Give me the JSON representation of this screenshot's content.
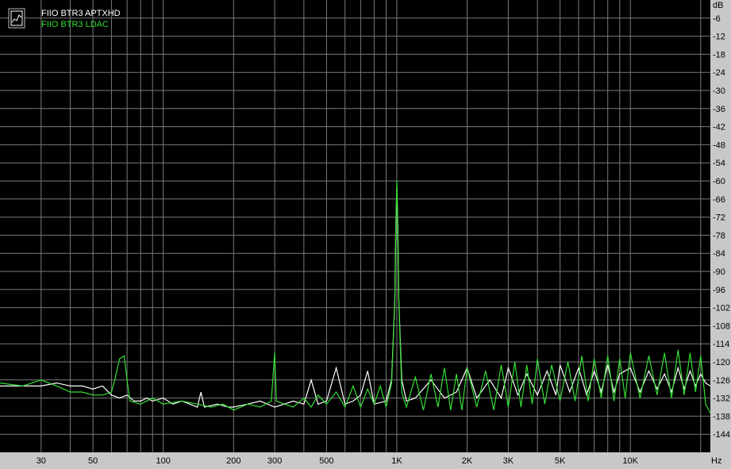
{
  "chart_data": {
    "type": "line",
    "ylabel": "dB",
    "xlabel": "Hz",
    "xscale": "log",
    "xlim": [
      20,
      22000
    ],
    "ylim": [
      -150,
      0
    ],
    "grid": true,
    "legend_position": "top-left",
    "y_ticks": [
      -6,
      -12,
      -18,
      -24,
      -30,
      -36,
      -42,
      -48,
      -54,
      -60,
      -66,
      -72,
      -78,
      -84,
      -90,
      -96,
      -102,
      -108,
      -114,
      -120,
      -126,
      -132,
      -138,
      -144
    ],
    "x_ticks": [
      {
        "value": 30,
        "label": "30"
      },
      {
        "value": 50,
        "label": "50"
      },
      {
        "value": 100,
        "label": "100"
      },
      {
        "value": 200,
        "label": "200"
      },
      {
        "value": 300,
        "label": "300"
      },
      {
        "value": 500,
        "label": "500"
      },
      {
        "value": 1000,
        "label": "1K"
      },
      {
        "value": 2000,
        "label": "2K"
      },
      {
        "value": 3000,
        "label": "3K"
      },
      {
        "value": 5000,
        "label": "5K"
      },
      {
        "value": 10000,
        "label": "10K"
      }
    ],
    "x_minor_grid": [
      40,
      60,
      70,
      80,
      90,
      400,
      600,
      700,
      800,
      900,
      4000,
      6000,
      7000,
      8000,
      9000,
      20000
    ],
    "series": [
      {
        "name": "FIIO BTR3 APTXHD",
        "color": "#ffffff",
        "points": [
          [
            20,
            -128
          ],
          [
            25,
            -128
          ],
          [
            30,
            -128
          ],
          [
            35,
            -127
          ],
          [
            40,
            -128
          ],
          [
            45,
            -128
          ],
          [
            50,
            -129
          ],
          [
            55,
            -128
          ],
          [
            60,
            -131
          ],
          [
            65,
            -132
          ],
          [
            70,
            -131
          ],
          [
            75,
            -133
          ],
          [
            80,
            -133
          ],
          [
            85,
            -132
          ],
          [
            90,
            -133
          ],
          [
            100,
            -132
          ],
          [
            110,
            -134
          ],
          [
            120,
            -133
          ],
          [
            130,
            -134
          ],
          [
            140,
            -135
          ],
          [
            145,
            -130
          ],
          [
            150,
            -135
          ],
          [
            170,
            -134
          ],
          [
            190,
            -135
          ],
          [
            200,
            -135
          ],
          [
            230,
            -134
          ],
          [
            260,
            -133
          ],
          [
            300,
            -135
          ],
          [
            330,
            -134
          ],
          [
            360,
            -133
          ],
          [
            400,
            -134
          ],
          [
            430,
            -126
          ],
          [
            460,
            -134
          ],
          [
            500,
            -133
          ],
          [
            550,
            -122
          ],
          [
            600,
            -134
          ],
          [
            650,
            -133
          ],
          [
            700,
            -131
          ],
          [
            750,
            -123
          ],
          [
            800,
            -134
          ],
          [
            900,
            -133
          ],
          [
            950,
            -126
          ],
          [
            980,
            -100
          ],
          [
            990,
            -75
          ],
          [
            1000,
            -62
          ],
          [
            1010,
            -75
          ],
          [
            1020,
            -100
          ],
          [
            1050,
            -126
          ],
          [
            1100,
            -133
          ],
          [
            1200,
            -132
          ],
          [
            1400,
            -126
          ],
          [
            1600,
            -132
          ],
          [
            1800,
            -130
          ],
          [
            2000,
            -122
          ],
          [
            2200,
            -132
          ],
          [
            2500,
            -126
          ],
          [
            2800,
            -132
          ],
          [
            3000,
            -122
          ],
          [
            3300,
            -131
          ],
          [
            3600,
            -124
          ],
          [
            4000,
            -131
          ],
          [
            4400,
            -123
          ],
          [
            4800,
            -131
          ],
          [
            5000,
            -121
          ],
          [
            5500,
            -130
          ],
          [
            6000,
            -122
          ],
          [
            6500,
            -131
          ],
          [
            7000,
            -123
          ],
          [
            7500,
            -130
          ],
          [
            8000,
            -121
          ],
          [
            8500,
            -130
          ],
          [
            9000,
            -124
          ],
          [
            10000,
            -122
          ],
          [
            11000,
            -130
          ],
          [
            12000,
            -123
          ],
          [
            13000,
            -129
          ],
          [
            14000,
            -124
          ],
          [
            15000,
            -130
          ],
          [
            16000,
            -122
          ],
          [
            17000,
            -129
          ],
          [
            18000,
            -123
          ],
          [
            19000,
            -128
          ],
          [
            20000,
            -124
          ],
          [
            21000,
            -127
          ],
          [
            22000,
            -128
          ]
        ]
      },
      {
        "name": "FIIO BTR3 LDAC",
        "color": "#33dd33",
        "points": [
          [
            20,
            -127
          ],
          [
            25,
            -128
          ],
          [
            30,
            -126
          ],
          [
            35,
            -128
          ],
          [
            40,
            -130
          ],
          [
            45,
            -130
          ],
          [
            50,
            -131
          ],
          [
            55,
            -131
          ],
          [
            60,
            -130
          ],
          [
            62,
            -126
          ],
          [
            65,
            -119
          ],
          [
            68,
            -118
          ],
          [
            70,
            -126
          ],
          [
            72,
            -133
          ],
          [
            80,
            -134
          ],
          [
            90,
            -132
          ],
          [
            100,
            -134
          ],
          [
            120,
            -133
          ],
          [
            140,
            -134
          ],
          [
            160,
            -135
          ],
          [
            180,
            -134
          ],
          [
            200,
            -136
          ],
          [
            230,
            -134
          ],
          [
            260,
            -135
          ],
          [
            290,
            -133
          ],
          [
            300,
            -117
          ],
          [
            305,
            -133
          ],
          [
            330,
            -134
          ],
          [
            360,
            -135
          ],
          [
            400,
            -132
          ],
          [
            430,
            -135
          ],
          [
            460,
            -131
          ],
          [
            500,
            -134
          ],
          [
            550,
            -130
          ],
          [
            600,
            -135
          ],
          [
            650,
            -128
          ],
          [
            700,
            -135
          ],
          [
            750,
            -129
          ],
          [
            800,
            -134
          ],
          [
            850,
            -128
          ],
          [
            900,
            -135
          ],
          [
            950,
            -127
          ],
          [
            980,
            -100
          ],
          [
            990,
            -75
          ],
          [
            1000,
            -60
          ],
          [
            1010,
            -75
          ],
          [
            1020,
            -100
          ],
          [
            1050,
            -130
          ],
          [
            1100,
            -135
          ],
          [
            1200,
            -125
          ],
          [
            1300,
            -136
          ],
          [
            1400,
            -124
          ],
          [
            1500,
            -135
          ],
          [
            1600,
            -122
          ],
          [
            1700,
            -136
          ],
          [
            1800,
            -124
          ],
          [
            1900,
            -136
          ],
          [
            2000,
            -122
          ],
          [
            2200,
            -135
          ],
          [
            2400,
            -123
          ],
          [
            2600,
            -136
          ],
          [
            2800,
            -121
          ],
          [
            3000,
            -135
          ],
          [
            3200,
            -120
          ],
          [
            3400,
            -135
          ],
          [
            3600,
            -121
          ],
          [
            3800,
            -134
          ],
          [
            4000,
            -119
          ],
          [
            4300,
            -134
          ],
          [
            4600,
            -121
          ],
          [
            5000,
            -133
          ],
          [
            5400,
            -120
          ],
          [
            5800,
            -133
          ],
          [
            6200,
            -118
          ],
          [
            6600,
            -133
          ],
          [
            7000,
            -119
          ],
          [
            7500,
            -132
          ],
          [
            8000,
            -118
          ],
          [
            8500,
            -133
          ],
          [
            9000,
            -119
          ],
          [
            9500,
            -132
          ],
          [
            10000,
            -117
          ],
          [
            11000,
            -132
          ],
          [
            12000,
            -118
          ],
          [
            13000,
            -131
          ],
          [
            14000,
            -117
          ],
          [
            15000,
            -132
          ],
          [
            16000,
            -116
          ],
          [
            17000,
            -131
          ],
          [
            18000,
            -117
          ],
          [
            19000,
            -130
          ],
          [
            20000,
            -118
          ],
          [
            21000,
            -134
          ],
          [
            22000,
            -137
          ]
        ]
      }
    ]
  }
}
